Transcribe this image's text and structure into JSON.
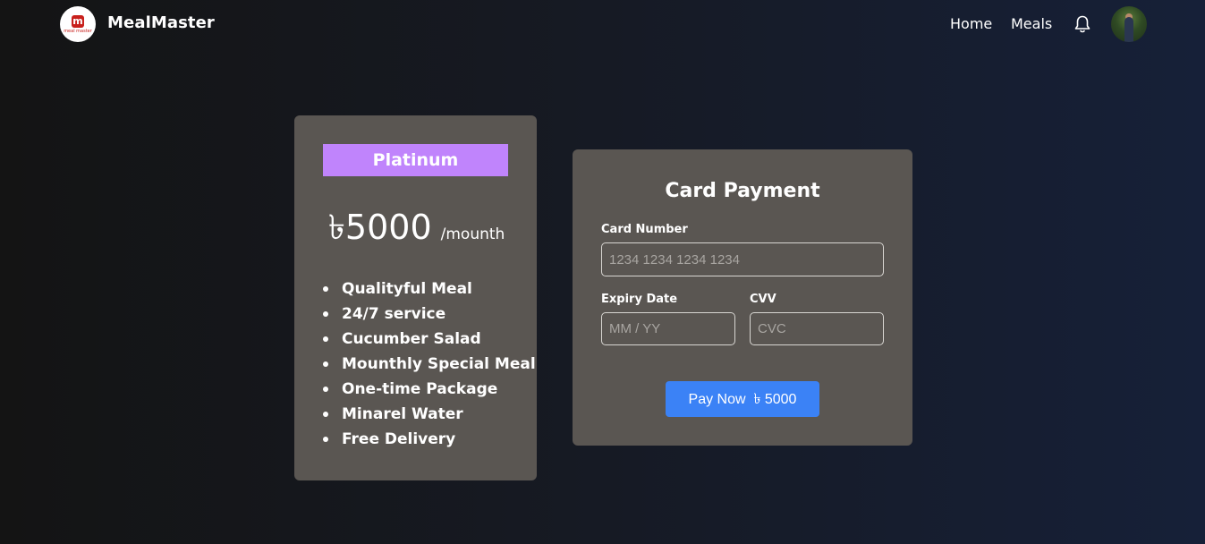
{
  "navbar": {
    "brand": "MealMaster",
    "logo_letter": "m",
    "logo_subtext": "meal master",
    "links": [
      "Home",
      "Meals"
    ],
    "bell_icon": "bell-icon",
    "avatar": "user-avatar"
  },
  "plan": {
    "name": "Platinum",
    "price": "৳5000",
    "period": "/mounth",
    "badge_color": "#c084fc",
    "features": [
      "Qualityful Meal",
      "24/7 service",
      "Cucumber Salad",
      "Mounthly Special Meal",
      "One-time Package",
      "Minarel Water",
      "Free Delivery"
    ]
  },
  "payment": {
    "title": "Card Payment",
    "card_number_label": "Card Number",
    "card_number_placeholder": "1234 1234 1234 1234",
    "expiry_label": "Expiry Date",
    "expiry_placeholder": "MM / YY",
    "cvv_label": "CVV",
    "cvv_placeholder": "CVC",
    "pay_button": "Pay Now  ৳ 5000",
    "button_color": "#3b82f6"
  },
  "colors": {
    "card_background": "#5a5652",
    "page_background_left": "#141414",
    "page_background_right": "#162038"
  }
}
